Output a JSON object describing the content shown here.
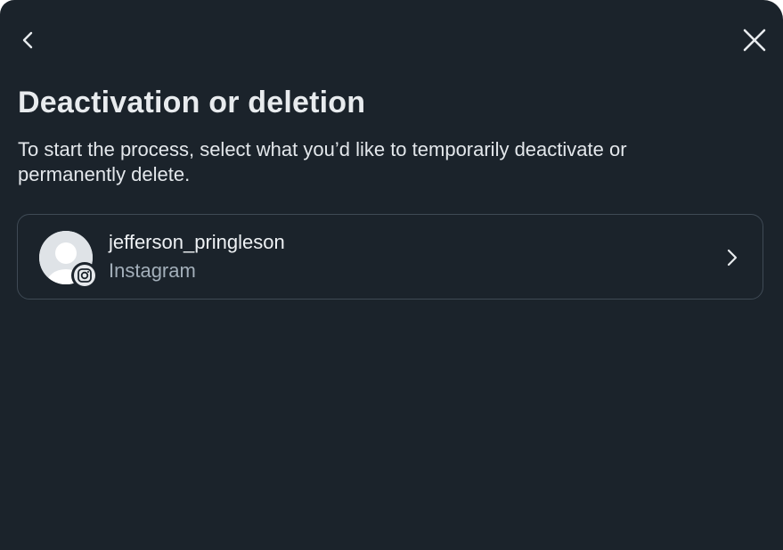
{
  "header": {
    "back_icon": "chevron-left-icon",
    "close_icon": "close-icon"
  },
  "page": {
    "title": "Deactivation or deletion",
    "subtitle": "To start the process, select what you’d like to temporarily deactivate or permanently delete."
  },
  "accounts": [
    {
      "username": "jefferson_pringleson",
      "platform": "Instagram",
      "avatar_icon": "default-avatar-icon",
      "badge_icon": "instagram-icon",
      "chevron_icon": "chevron-right-icon"
    }
  ],
  "colors": {
    "background": "#1b232b",
    "text_primary": "#e8ebee",
    "text_secondary": "#a3afba",
    "card_border": "#3f4a55"
  }
}
